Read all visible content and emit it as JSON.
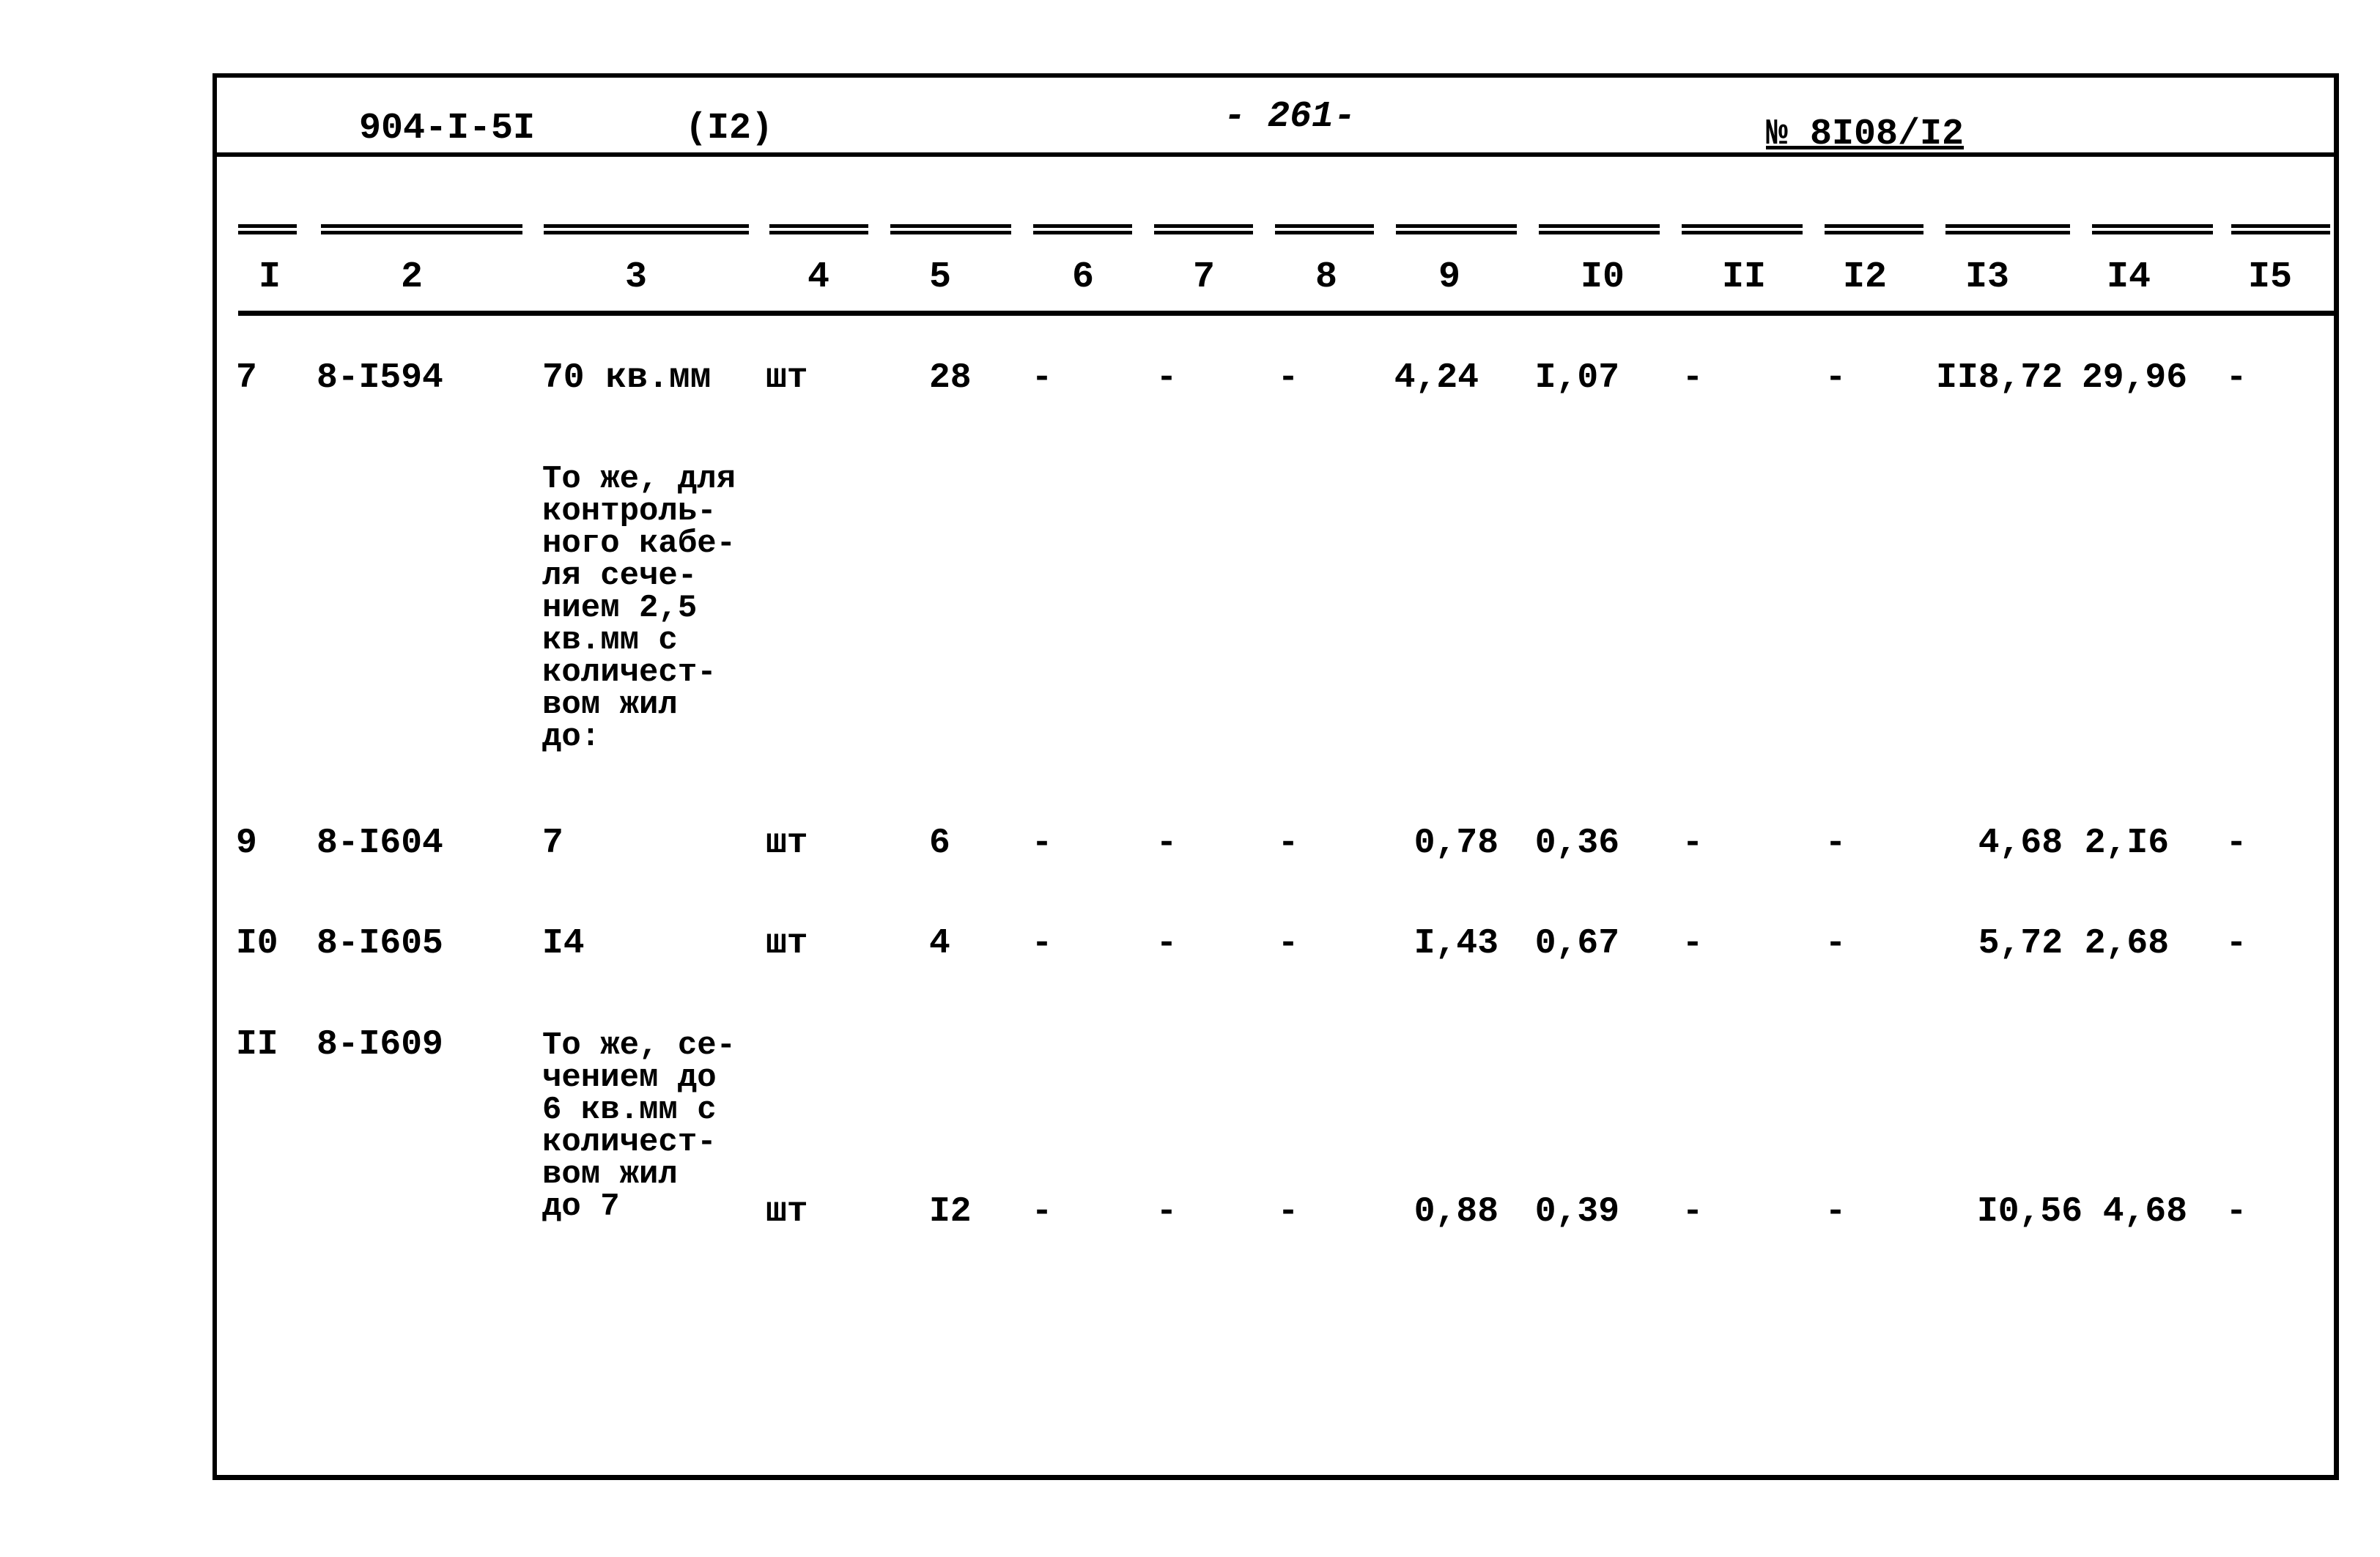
{
  "header": {
    "doc_code": "904-I-5I",
    "section": "(I2)",
    "page_number": "- 261-",
    "order_number": "№ 8I08/I2"
  },
  "columns": [
    "I",
    "2",
    "3",
    "4",
    "5",
    "6",
    "7",
    "8",
    "9",
    "I0",
    "II",
    "I2",
    "I3",
    "I4",
    "I5"
  ],
  "rows": [
    {
      "c1": "7",
      "c2": "8-I594",
      "c3": "70 кв.мм",
      "c4": "шт",
      "c5": "28",
      "c6": "-",
      "c7": "-",
      "c8": "-",
      "c9": "4,24",
      "c10": "I,07",
      "c11": "-",
      "c12": "-",
      "c13": "II8,72",
      "c14": "29,96",
      "c15": "-"
    },
    {
      "note": "То же, для\nконтроль-\nного кабе-\nля сече-\nнием 2,5\nкв.мм с\nколичест-\nвом жил\nдо:"
    },
    {
      "c1": "9",
      "c2": "8-I604",
      "c3": "7",
      "c4": "шт",
      "c5": "6",
      "c6": "-",
      "c7": "-",
      "c8": "-",
      "c9": "0,78",
      "c10": "0,36",
      "c11": "-",
      "c12": "-",
      "c13": "4,68",
      "c14": "2,I6",
      "c15": "-"
    },
    {
      "c1": "I0",
      "c2": "8-I605",
      "c3": "I4",
      "c4": "шт",
      "c5": "4",
      "c6": "-",
      "c7": "-",
      "c8": "-",
      "c9": "I,43",
      "c10": "0,67",
      "c11": "-",
      "c12": "-",
      "c13": "5,72",
      "c14": "2,68",
      "c15": "-"
    },
    {
      "c1": "II",
      "c2": "8-I609",
      "c3": "То же, се-\nчением до\n6 кв.мм с\nколичест-\nвом жил\nдо 7",
      "c4": "шт",
      "c5": "I2",
      "c6": "-",
      "c7": "-",
      "c8": "-",
      "c9": "0,88",
      "c10": "0,39",
      "c11": "-",
      "c12": "-",
      "c13": "I0,56",
      "c14": "4,68",
      "c15": "-"
    }
  ]
}
